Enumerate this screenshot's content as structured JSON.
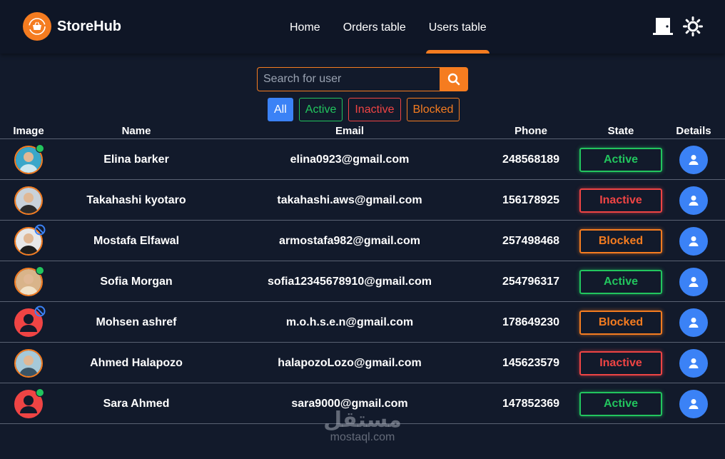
{
  "app": {
    "name": "StoreHub",
    "brand_color": "#f57c20",
    "accent_color": "#3b82f6",
    "background": "#121a2b"
  },
  "nav": {
    "links": [
      {
        "label": "Home",
        "active": false
      },
      {
        "label": "Orders table",
        "active": false
      },
      {
        "label": "Users table",
        "active": true
      }
    ],
    "icons": [
      "door-logout-icon",
      "sun-theme-icon"
    ]
  },
  "search": {
    "placeholder": "Search for user",
    "value": "",
    "button_icon": "search-icon"
  },
  "filters": [
    {
      "label": "All",
      "selected": true
    },
    {
      "label": "Active",
      "selected": false
    },
    {
      "label": "Inactive",
      "selected": false
    },
    {
      "label": "Blocked",
      "selected": false
    }
  ],
  "table": {
    "headers": [
      "Image",
      "Name",
      "Email",
      "Phone",
      "State",
      "Details"
    ],
    "rows": [
      {
        "name": "Elina barker",
        "email": "elina0923@gmail.com",
        "phone": "248568189",
        "state": "Active",
        "avatar": "photo"
      },
      {
        "name": "Takahashi kyotaro",
        "email": "takahashi.aws@gmail.com",
        "phone": "156178925",
        "state": "Inactive",
        "avatar": "photo"
      },
      {
        "name": "Mostafa Elfawal",
        "email": "armostafa982@gmail.com",
        "phone": "257498468",
        "state": "Blocked",
        "avatar": "photo"
      },
      {
        "name": "Sofia Morgan",
        "email": "sofia12345678910@gmail.com",
        "phone": "254796317",
        "state": "Active",
        "avatar": "photo"
      },
      {
        "name": "Mohsen ashref",
        "email": "m.o.h.s.e.n@gmail.com",
        "phone": "178649230",
        "state": "Blocked",
        "avatar": "default"
      },
      {
        "name": "Ahmed Halapozo",
        "email": "halapozoLozo@gmail.com",
        "phone": "145623579",
        "state": "Inactive",
        "avatar": "photo"
      },
      {
        "name": "Sara Ahmed",
        "email": "sara9000@gmail.com",
        "phone": "147852369",
        "state": "Active",
        "avatar": "default"
      }
    ]
  },
  "watermark": {
    "arabic": "مستقل",
    "latin": "mostaql.com"
  }
}
